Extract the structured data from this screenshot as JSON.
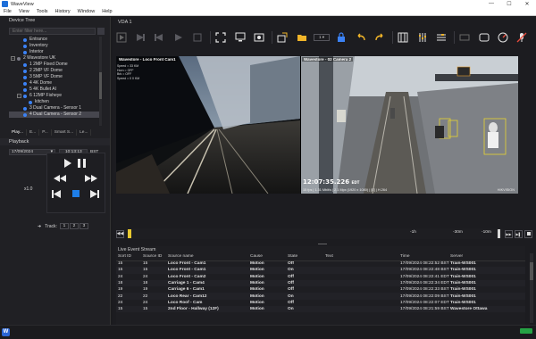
{
  "app": {
    "title": "WaveView",
    "min": "—",
    "max": "☐",
    "close": "✕"
  },
  "menu": [
    "File",
    "View",
    "Tools",
    "History",
    "Window",
    "Help"
  ],
  "device_tree": {
    "header": "Device Tree",
    "filter_placeholder": "Enter filter here...",
    "items": [
      {
        "label": "Entrance",
        "type": "camera",
        "indent": 2
      },
      {
        "label": "Inventory",
        "type": "camera",
        "indent": 2
      },
      {
        "label": "Interior",
        "type": "camera",
        "indent": 2
      },
      {
        "label": "2 Wavestore UK",
        "type": "group",
        "indent": 0,
        "exp": "−"
      },
      {
        "label": "1 2MP Fixed Dome",
        "type": "camera",
        "indent": 1
      },
      {
        "label": "2 2MP VF Dome",
        "type": "camera",
        "indent": 1
      },
      {
        "label": "3 5MP VF Dome",
        "type": "camera",
        "indent": 1
      },
      {
        "label": "4 4K Dome",
        "type": "camera",
        "indent": 1
      },
      {
        "label": "5 4K Bullet AI",
        "type": "camera",
        "indent": 1
      },
      {
        "label": "6 12MP Fisheye",
        "type": "group",
        "indent": 1,
        "exp": "−"
      },
      {
        "label": "kitchen",
        "type": "camera",
        "indent": 2
      },
      {
        "label": "3 Dual Camera - Sensor 1",
        "type": "camera",
        "indent": 1
      },
      {
        "label": "4 Dual Camera - Sensor 2",
        "type": "camera",
        "indent": 1,
        "selected": true
      }
    ]
  },
  "left_tabs": [
    "Play...",
    "E...",
    "P...",
    "Smart S...",
    "Le..."
  ],
  "playback": {
    "header": "Playback",
    "date": "17/09/2024",
    "time": "10:13:13",
    "tz": "BST",
    "speed": "x1.0",
    "track_label": "Track:",
    "tracks": [
      "1",
      "2",
      "3"
    ]
  },
  "view": {
    "tab": "VDA 1",
    "dropdown": "1",
    "cameras": [
      {
        "title": "Wavestore - Loco Front Cam1",
        "info": [
          "Speed = 33 KM",
          "Horn = OFF",
          "Brk = OFF",
          "Speed = 0 0 KM"
        ]
      },
      {
        "title": "Wavestore - 02 Camera 2",
        "time": "12:07:35.226",
        "tz": "EDT",
        "meta": "15 fps  |  1.31 Mbit/s  |  2.1 Mpx  (1920 x 1080)  |  [E]  |  H.264",
        "brand": "HIKVISION"
      }
    ]
  },
  "timeline": {
    "labels": [
      "-1h",
      "-30m",
      "-10m"
    ]
  },
  "events": {
    "header": "Live Event Stream",
    "columns": [
      "Sort ID",
      "Source ID",
      "Source name",
      "Cause",
      "State",
      "Text",
      "Time",
      "Server"
    ],
    "rows": [
      [
        "15",
        "15",
        "Loco Front - Cam1",
        "Motion",
        "Off",
        "",
        "17/09/2024 08:22:52 BST",
        "Train-WS001"
      ],
      [
        "15",
        "15",
        "Loco Front - Cam1",
        "Motion",
        "On",
        "",
        "17/09/2024 08:22:48 BST",
        "Train-WS001"
      ],
      [
        "24",
        "24",
        "Loco Front - Cam2",
        "Motion",
        "Off",
        "",
        "17/09/2024 08:22:41 EDT",
        "Train-WS001"
      ],
      [
        "18",
        "18",
        "Carriage 1 - Cam4",
        "Motion",
        "Off",
        "",
        "17/09/2024 08:22:34 EDT",
        "Train-WS001"
      ],
      [
        "19",
        "19",
        "Carriage 6 - Cam1",
        "Motion",
        "Off",
        "",
        "17/09/2024 08:22:33 BST",
        "Train-WS001"
      ],
      [
        "22",
        "22",
        "Loco Rear - Cam12",
        "Motion",
        "On",
        "",
        "17/09/2024 08:22:09 BST",
        "Train-WS001"
      ],
      [
        "24",
        "24",
        "Loco Roof - Cam",
        "Motion",
        "Off",
        "",
        "17/09/2024 08:22:07 EDT",
        "Train-WS001"
      ],
      [
        "15",
        "15",
        "2nd Floor - Hallway (12F)",
        "Motion",
        "On",
        "",
        "17/09/2024 08:21:59 BST",
        "Wavestore Ottawa"
      ]
    ]
  },
  "colors": {
    "accent": "#1e6fd9",
    "status_ok": "#25a244",
    "timeline_marker": "#e8c830"
  }
}
